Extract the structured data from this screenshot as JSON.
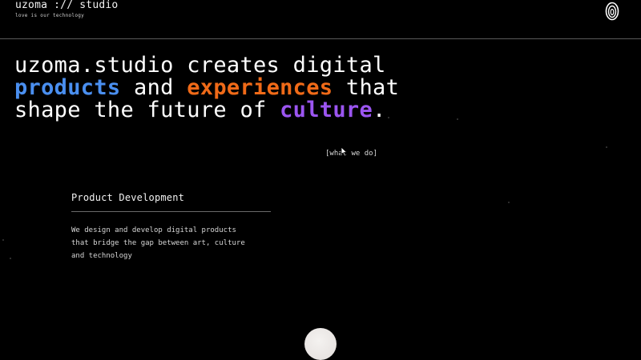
{
  "header": {
    "brand": "uzoma :// studio",
    "tagline": "love is our technology",
    "logo_icon": "swirl-logo-icon"
  },
  "hero": {
    "line1": "uzoma.studio creates digital",
    "word_products": "products",
    "word_and": " and ",
    "word_experiences": "experiences",
    "word_that": " that",
    "line3_start": "shape the future of ",
    "word_culture": "culture",
    "period": ".",
    "colors": {
      "products": "#4a8ff0",
      "experiences": "#f06a18",
      "culture": "#9b55f0"
    }
  },
  "link": {
    "what_we_do": "[what we do]"
  },
  "service": {
    "title": "Product Development",
    "desc_line1": "We design and develop digital products",
    "desc_line2": "that bridge the gap between art, culture",
    "desc_line3": "and technology"
  }
}
